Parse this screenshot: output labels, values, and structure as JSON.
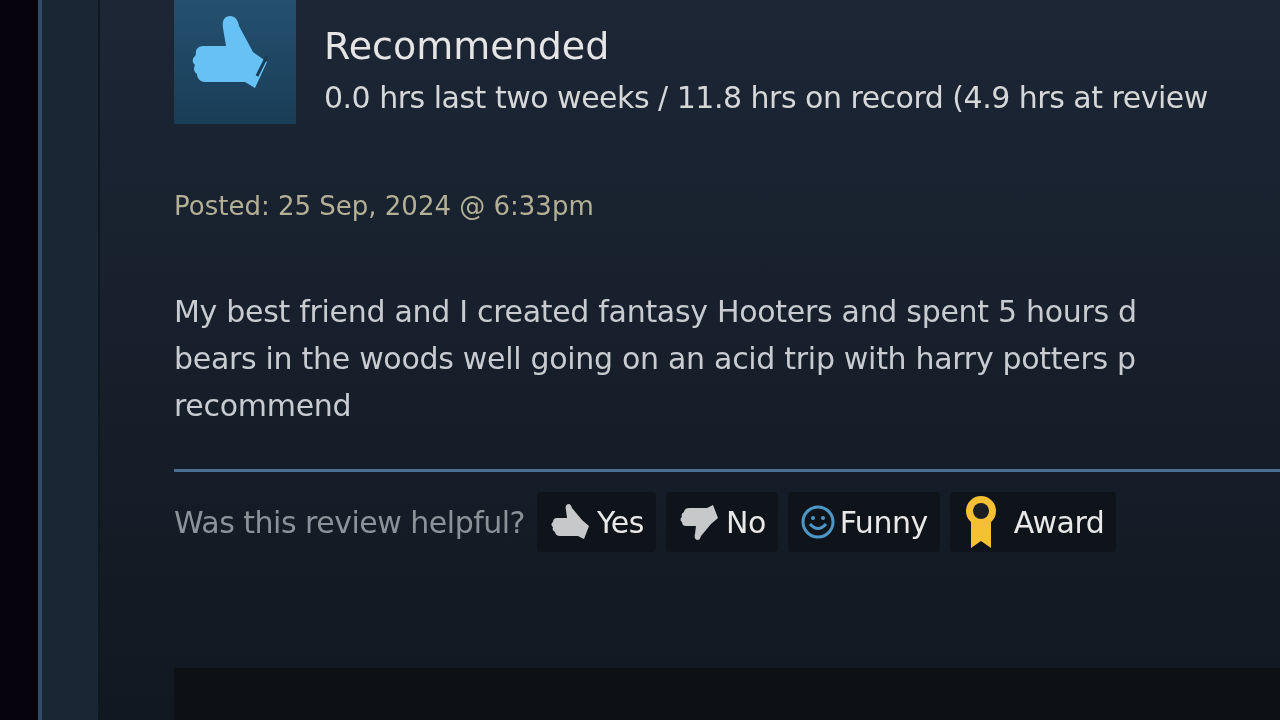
{
  "review": {
    "verdict": "Recommended",
    "hours": "0.0 hrs last two weeks / 11.8 hrs on record (4.9 hrs at review",
    "posted": "Posted: 25 Sep, 2024 @ 6:33pm",
    "text": "My best friend and I created fantasy Hooters and spent 5 hours d\nbears in the woods well going on an acid trip with harry potters p\nrecommend"
  },
  "helpful": {
    "prompt": "Was this review helpful?",
    "buttons": [
      {
        "kind": "yes",
        "label": "Yes"
      },
      {
        "kind": "no",
        "label": "No"
      },
      {
        "kind": "funny",
        "label": "Funny"
      },
      {
        "kind": "award",
        "label": "Award"
      }
    ]
  }
}
